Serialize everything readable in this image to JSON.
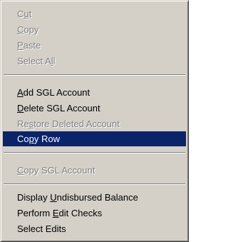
{
  "colors": {
    "menu_background": "#d4d0c8",
    "highlight": "#0a246a",
    "disabled_text": "#808080"
  },
  "menu": {
    "cut": {
      "pre": "C",
      "mn": "u",
      "post": "t",
      "enabled": false
    },
    "copy": {
      "pre": "",
      "mn": "C",
      "post": "opy",
      "enabled": false
    },
    "paste": {
      "pre": "",
      "mn": "P",
      "post": "aste",
      "enabled": false
    },
    "select_all": {
      "pre": "Select A",
      "mn": "l",
      "post": "l",
      "enabled": false
    },
    "add_sgl_account": {
      "pre": "",
      "mn": "A",
      "post": "dd SGL Account",
      "enabled": true
    },
    "delete_sgl_account": {
      "pre": "",
      "mn": "D",
      "post": "elete SGL Account",
      "enabled": true
    },
    "restore_deleted_account": {
      "pre": "Re",
      "mn": "s",
      "post": "tore Deleted Account",
      "enabled": false
    },
    "copy_row": {
      "pre": "Co",
      "mn": "p",
      "post": "y Row",
      "enabled": true,
      "selected": true
    },
    "copy_sgl_account": {
      "pre": "",
      "mn": "C",
      "post": "opy SGL Account",
      "enabled": false
    },
    "display_undisbursed_balance": {
      "pre": "Display ",
      "mn": "U",
      "post": "ndisbursed Balance",
      "enabled": true
    },
    "perform_edit_checks": {
      "pre": "Perform ",
      "mn": "E",
      "post": "dit Checks",
      "enabled": true
    },
    "select_edits": {
      "pre": "Select Edits",
      "mn": "",
      "post": "",
      "enabled": true
    }
  }
}
